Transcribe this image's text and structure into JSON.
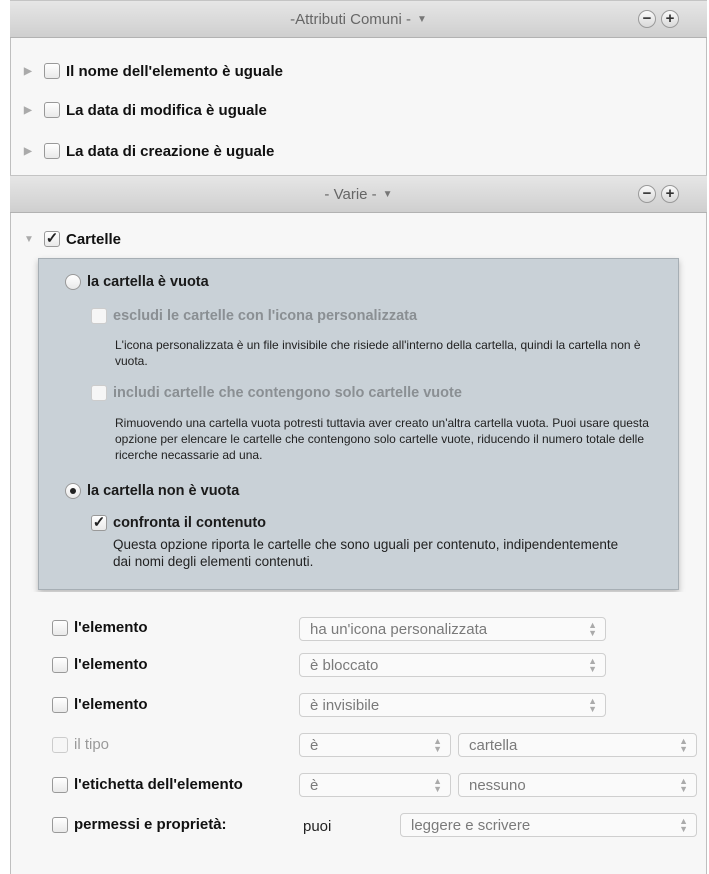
{
  "section_common": {
    "title": "-Attributi Comuni -",
    "minus": "−",
    "plus": "+"
  },
  "common_rows": [
    {
      "label": "Il nome dell'elemento è uguale"
    },
    {
      "label": "La data di modifica è uguale"
    },
    {
      "label": "La data di creazione è uguale"
    }
  ],
  "section_misc": {
    "title": "- Varie -",
    "minus": "−",
    "plus": "+"
  },
  "folders": {
    "label": "Cartelle",
    "checked": true,
    "empty_radio": "la cartella è vuota",
    "exclude_custom_icon": "escludi le cartelle con l'icona personalizzata",
    "exclude_note": "L'icona personalizzata è un file invisibile che risiede all'interno della cartella, quindi la cartella non è vuota.",
    "include_empty": "includi cartelle che contengono solo cartelle vuote",
    "include_note": "Rimuovendo una cartella vuota potresti tuttavia aver creato un'altra cartella vuota. Puoi usare questa opzione per elencare le cartelle che contengono solo cartelle vuote, riducendo il numero totale delle ricerche necassarie ad una.",
    "not_empty_radio": "la cartella non è vuota",
    "compare_content": "confronta il contenuto",
    "compare_note": "Questa opzione riporta le cartelle che sono uguali per contenuto, indipendentemente dai nomi degli elementi contenuti."
  },
  "criteria": [
    {
      "label": "l'elemento",
      "select1": "ha un'icona personalizzata"
    },
    {
      "label": "l'elemento",
      "select1": "è bloccato"
    },
    {
      "label": "l'elemento",
      "select1": "è invisibile"
    },
    {
      "label": "il tipo",
      "select1": "è",
      "select2": "cartella",
      "disabled": true
    },
    {
      "label": "l'etichetta dell'elemento",
      "select1": "è",
      "select2": "nessuno"
    },
    {
      "label": "permessi e proprietà:",
      "text": "puoi",
      "select2": "leggere e scrivere"
    }
  ],
  "icons": {
    "expand": "triangle-right-icon",
    "collapse": "triangle-down-icon",
    "popup": "popup-arrows-icon"
  },
  "colors": {
    "panel": "#c9d1d7",
    "header": "#d9d9d9"
  }
}
